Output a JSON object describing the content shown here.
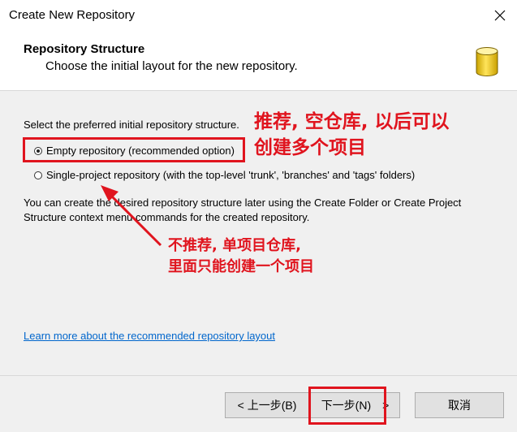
{
  "window": {
    "title": "Create New Repository",
    "close_glyph": "✕"
  },
  "header": {
    "title": "Repository Structure",
    "subtitle": "Choose the initial layout for the new repository.",
    "icon": "database-icon"
  },
  "body": {
    "prompt": "Select the preferred initial repository structure.",
    "options": [
      {
        "label": "Empty repository (recommended option)",
        "selected": true
      },
      {
        "label": "Single-project repository (with the top-level 'trunk', 'branches' and 'tags' folders)",
        "selected": false
      }
    ],
    "help_line1": "You can create the desired repository structure later using the Create Folder or Create Project",
    "help_line2": "Structure context menu commands for the created repository.",
    "learn_more_link": "Learn more about the recommended repository layout"
  },
  "buttons": {
    "back": "< 上一步(B)",
    "next": "下一步(N)",
    "next_suffix": ">",
    "cancel": "取消"
  },
  "annotations": {
    "note1_line1": "推荐, 空仓库, 以后可以",
    "note1_line2": "创建多个项目",
    "note2_line1": "不推荐, 单项目仓库,",
    "note2_line2": "里面只能创建一个项目",
    "accent_color": "#e0141e"
  }
}
